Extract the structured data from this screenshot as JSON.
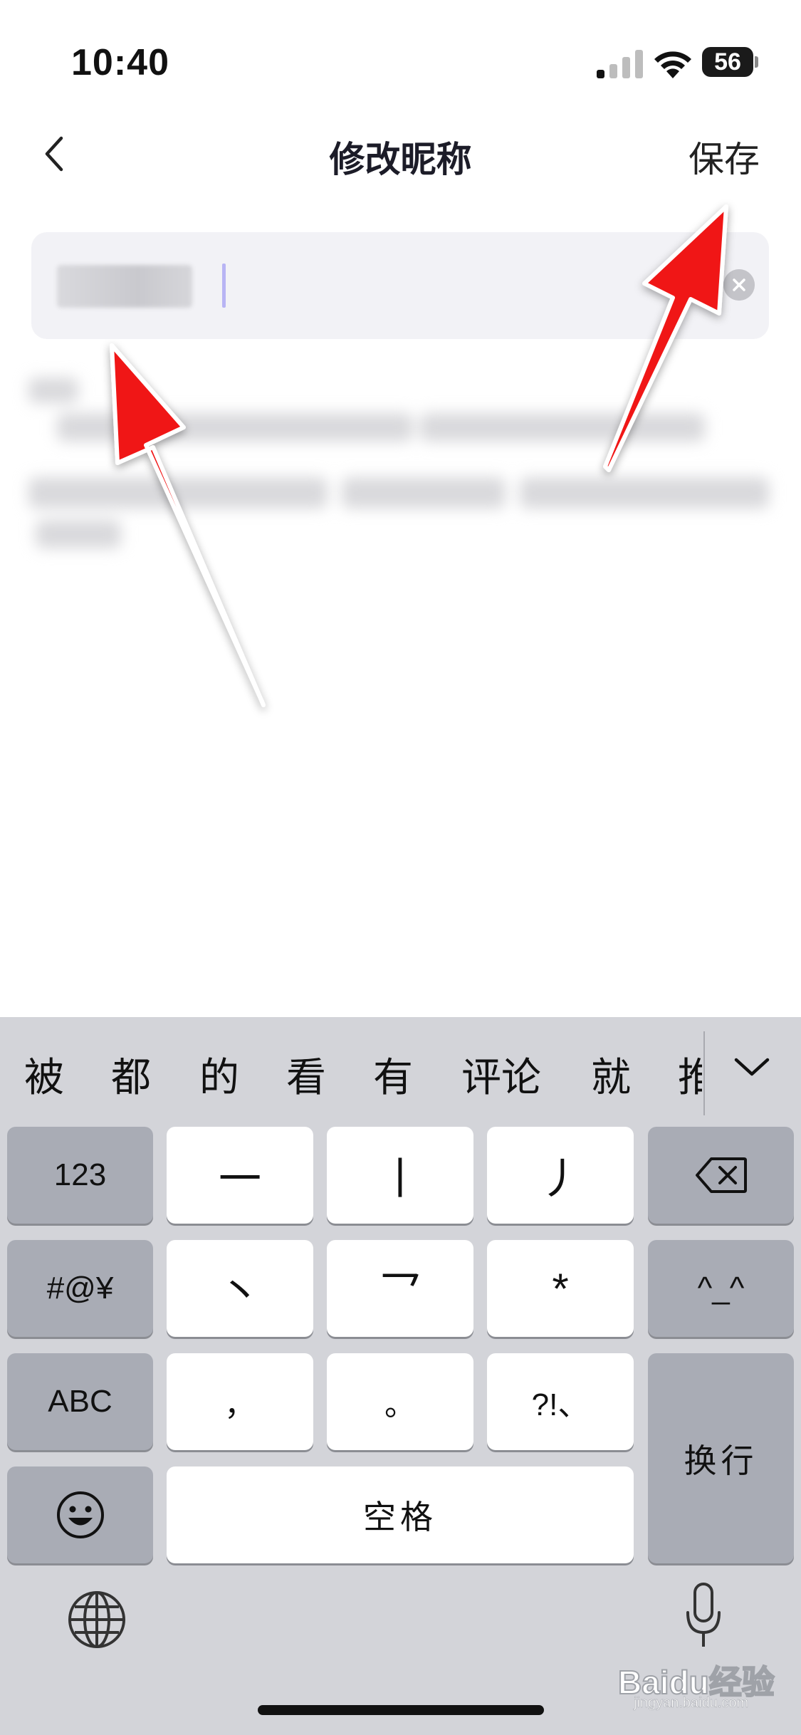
{
  "status_bar": {
    "time": "10:40",
    "battery": "56"
  },
  "nav": {
    "title": "修改昵称",
    "save_label": "保存"
  },
  "input": {
    "value": "••••••"
  },
  "keyboard": {
    "candidates": [
      "被",
      "都",
      "的",
      "看",
      "有",
      "评论",
      "就",
      "推"
    ],
    "keys": {
      "numbers": "123",
      "stroke_heng": "一",
      "stroke_shu": "丨",
      "stroke_pie": "丿",
      "symbols": "#@¥",
      "stroke_dian": "丶",
      "stroke_zhe": "乛",
      "wildcard": "*",
      "emoticon": "^_^",
      "abc": "ABC",
      "comma": "，",
      "period": "。",
      "punct": "?!、",
      "return": "换行",
      "space": "空格"
    }
  },
  "watermark": {
    "brand": "Baidu经验",
    "url": "jingyan.baidu.com"
  },
  "colors": {
    "arrow": "#f01414",
    "keyboard_bg": "#d3d4d9",
    "caret": "#b8b4f4"
  }
}
